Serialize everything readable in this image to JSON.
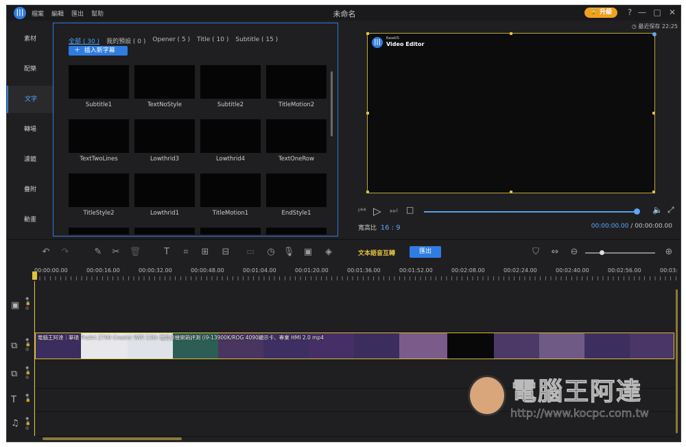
{
  "app": {
    "title": "未命名",
    "logo_glyph": "|||",
    "menu": [
      "檔案",
      "編輯",
      "匯出",
      "幫助"
    ],
    "upgrade_label": "升級",
    "window_controls": [
      "?",
      "—",
      "□",
      "✕"
    ]
  },
  "sidebar": {
    "items": [
      {
        "label": "素材",
        "active": false
      },
      {
        "label": "配樂",
        "active": false
      },
      {
        "label": "文字",
        "active": true
      },
      {
        "label": "轉場",
        "active": false
      },
      {
        "label": "濾鏡",
        "active": false
      },
      {
        "label": "疊附",
        "active": false
      },
      {
        "label": "動畫",
        "active": false
      }
    ]
  },
  "media_panel": {
    "filters": [
      {
        "label": "全部 ( 30 )",
        "active": true
      },
      {
        "label": "我的預設 ( 0 )",
        "active": false
      },
      {
        "label": "Opener ( 5 )",
        "active": false
      },
      {
        "label": "Title ( 10 )",
        "active": false
      },
      {
        "label": "Subtitle ( 15 )",
        "active": false
      }
    ],
    "insert_button": "插入新字幕",
    "templates": [
      "Subtitle1",
      "TextNoStyle",
      "Subtitle2",
      "TitleMotion2",
      "TextTwoLines",
      "Lowthrid3",
      "Lowthrid4",
      "TextOneRow",
      "TitleStyle2",
      "Lowthrid1",
      "TitleMotion1",
      "EndStyle1"
    ]
  },
  "preview": {
    "saved_status": "最近保存 22:25",
    "watermark_brand": "EaseUS",
    "watermark_product": "Video Editor",
    "aspect_label": "寬高比",
    "aspect_value": "16 : 9",
    "current_time": "00:00:00.00",
    "total_time": "/ 00:00:00.00",
    "progress": 1.0
  },
  "toolbar": {
    "tts_label": "文本語音互轉",
    "export_label": "匯出",
    "zoom_level": 0.25
  },
  "ruler": {
    "ticks": [
      "00:00:00.00",
      "00:00:16.00",
      "00:00:32.00",
      "00:00:48.00",
      "00:01:04.00",
      "00:01:20.00",
      "00:01:36.00",
      "00:01:52.00",
      "00:02:08.00",
      "00:02:24.00",
      "00:02:40.00",
      "00:02:56.00",
      "00:03:"
    ]
  },
  "timeline": {
    "clip_name": "電腦王阿達｜華碩 ProArt Z790 Creator WiFi 13th 電競桌機開箱評測 (i9-13900K/ROG 4090顯示卡、專業 HMI 2.0 mp4"
  },
  "site_watermark": {
    "title": "電腦王阿達",
    "url": "http://www.kocpc.com.tw"
  }
}
